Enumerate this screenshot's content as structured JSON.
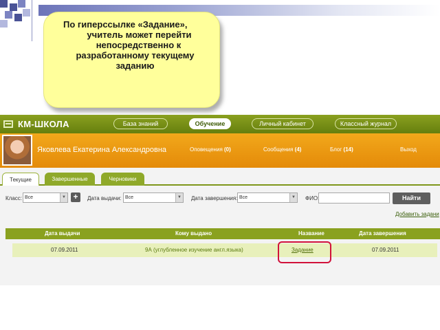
{
  "colors": {
    "brand_green": "#7d961a",
    "user_bar_orange": "#eb9810",
    "callout_yellow": "#ffff9b",
    "highlight_red": "#d1113a"
  },
  "callout": {
    "lines": [
      "По гиперссылке «Задание»,",
      "учитель может перейти",
      "непосредственно к",
      "разработанному текущему",
      "заданию"
    ]
  },
  "app": {
    "logo_text": "КМ-ШКОЛА",
    "logo_icon": "monitor-icon",
    "nav": [
      "База знаний",
      "Обучение",
      "Личный кабинет",
      "Классный журнал"
    ],
    "nav_active": "Обучение",
    "user": {
      "name": "Яковлева Екатерина Александровна",
      "notifications_label": "Оповещения",
      "notifications_count": "(0)",
      "messages_label": "Сообщения",
      "messages_count": "(4)",
      "blog_label": "Блог",
      "blog_count": "(14)",
      "logout": "Выход"
    },
    "tabs": [
      "Текущие",
      "Завершенные",
      "Черновики"
    ],
    "tab_active": "Текущие",
    "filters": {
      "class_label": "Класс:",
      "class_value": "Все",
      "issue_date_label": "Дата выдачи:",
      "issue_date_value": "Все",
      "end_date_label": "Дата завершения:",
      "end_date_value": "Все",
      "fio_label": "ФИО:",
      "fio_value": "",
      "find_button": "Найти",
      "add_link": "Добавить задани"
    },
    "table": {
      "headers": [
        "Дата выдачи",
        "Кому выдано",
        "Название",
        "Дата завершения"
      ],
      "rows": [
        {
          "issue_date": "07.09.2011",
          "assigned_to": "9А (углубленное изучение англ.языка)",
          "name": "Задание",
          "end_date": "07.09.2011"
        }
      ]
    }
  }
}
